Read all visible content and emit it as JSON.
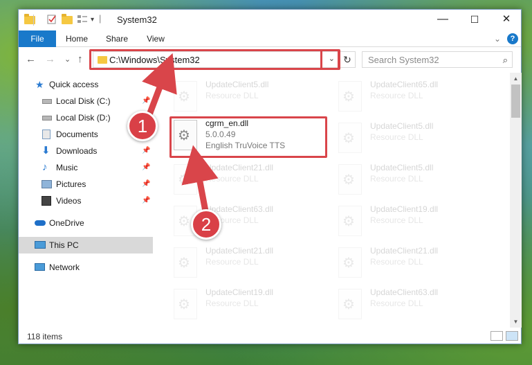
{
  "window": {
    "title": "System32",
    "minimize": "—",
    "maximize": "☐",
    "close": "✕"
  },
  "ribbon": {
    "tabs": [
      "File",
      "Home",
      "Share",
      "View"
    ],
    "expand_icon": "⌄",
    "help_icon": "?"
  },
  "nav": {
    "back": "←",
    "forward": "→",
    "recent": "⌄",
    "up": "↑",
    "address": "C:\\Windows\\System32",
    "address_dropdown": "⌄",
    "refresh": "↻",
    "search_placeholder": "Search System32",
    "search_icon": "⌕"
  },
  "sidebar": {
    "items": [
      {
        "label": "Quick access",
        "icon": "star-icon",
        "pinned": false
      },
      {
        "label": "Local Disk (C:)",
        "icon": "drive-icon",
        "pinned": true
      },
      {
        "label": "Local Disk (D:)",
        "icon": "drive-icon",
        "pinned": false
      },
      {
        "label": "Documents",
        "icon": "documents-icon",
        "pinned": true
      },
      {
        "label": "Downloads",
        "icon": "download-icon",
        "pinned": true
      },
      {
        "label": "Music",
        "icon": "music-icon",
        "pinned": true
      },
      {
        "label": "Pictures",
        "icon": "pictures-icon",
        "pinned": true
      },
      {
        "label": "Videos",
        "icon": "videos-icon",
        "pinned": true
      },
      {
        "label": "OneDrive",
        "icon": "cloud-icon",
        "pinned": false
      },
      {
        "label": "This PC",
        "icon": "computer-icon",
        "pinned": false,
        "selected": true
      },
      {
        "label": "Network",
        "icon": "network-icon",
        "pinned": false
      }
    ],
    "pin_glyph": "📌"
  },
  "files": {
    "left_column": [
      {
        "name": "UpdateClient5.dll",
        "desc": "Resource DLL"
      },
      {
        "name": "UpdateClient21.dll",
        "desc": "Resource DLL"
      },
      {
        "name": "UpdateClient63.dll",
        "desc": "Resource DLL"
      },
      {
        "name": "UpdateClient21.dll",
        "desc": "Resource DLL"
      },
      {
        "name": "UpdateClient19.dll",
        "desc": "Resource DLL"
      }
    ],
    "right_column": [
      {
        "name": "UpdateClient65.dll",
        "desc": "Resource DLL"
      },
      {
        "name": "UpdateClient5.dll",
        "desc": "Resource DLL"
      },
      {
        "name": "UpdateClient5.dll",
        "desc": "Resource DLL"
      },
      {
        "name": "UpdateClient19.dll",
        "desc": "Resource DLL"
      },
      {
        "name": "UpdateClient21.dll",
        "desc": "Resource DLL"
      },
      {
        "name": "UpdateClient63.dll",
        "desc": "Resource DLL"
      }
    ],
    "highlighted": {
      "name": "cgrm_en.dll",
      "version": "5.0.0.49",
      "desc": "English TruVoice TTS"
    }
  },
  "status": {
    "item_count": "118 items"
  },
  "callouts": [
    "1",
    "2"
  ],
  "colors": {
    "accent": "#1979ca",
    "highlight_red": "#d9454a",
    "selected": "#d9d9d9"
  }
}
